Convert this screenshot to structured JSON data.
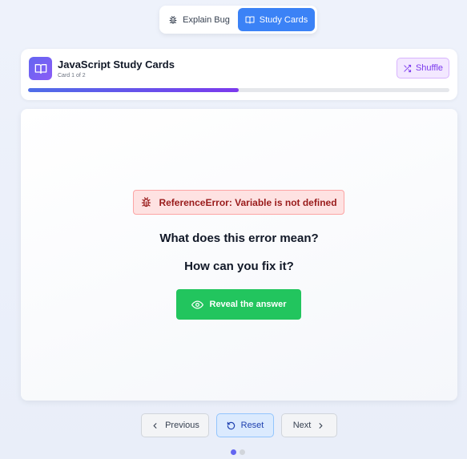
{
  "mode_toggle": {
    "explain_label": "Explain Bug",
    "study_label": "Study Cards",
    "active": "study"
  },
  "header": {
    "title": "JavaScript Study Cards",
    "subtitle": "Card 1 of 2",
    "shuffle_label": "Shuffle",
    "progress": 0.5
  },
  "card": {
    "error": "ReferenceError: Variable is not defined",
    "question_1": "What does this error mean?",
    "question_2": "How can you fix it?",
    "reveal_label": "Reveal the answer"
  },
  "nav": {
    "previous_label": "Previous",
    "reset_label": "Reset",
    "next_label": "Next"
  },
  "pagination": {
    "total": 2,
    "current": 1
  },
  "colors": {
    "accent_blue": "#3b82f6",
    "accent_purple": "#7c3aed",
    "success_green": "#22c55e",
    "error_red": "#991b1b"
  }
}
